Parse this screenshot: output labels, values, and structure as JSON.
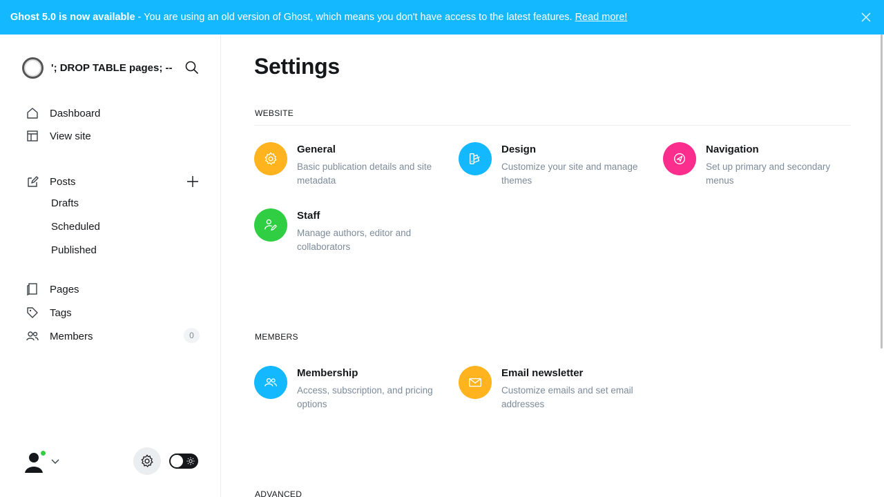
{
  "banner": {
    "bold": "Ghost 5.0 is now available",
    "text": "- You are using an old version of Ghost, which means you don't have access to the latest features.",
    "link": "Read more!"
  },
  "sidebar": {
    "site_title": "'; DROP TABLE pages; --",
    "nav": {
      "dashboard": "Dashboard",
      "view_site": "View site",
      "posts": "Posts",
      "drafts": "Drafts",
      "scheduled": "Scheduled",
      "published": "Published",
      "pages": "Pages",
      "tags": "Tags",
      "members": "Members",
      "members_count": "0"
    }
  },
  "main": {
    "title": "Settings",
    "sections": {
      "website": "WEBSITE",
      "members": "MEMBERS",
      "advanced": "ADVANCED"
    },
    "cards": {
      "general": {
        "title": "General",
        "desc": "Basic publication details and site metadata",
        "color": "#ffb41f"
      },
      "design": {
        "title": "Design",
        "desc": "Customize your site and manage themes",
        "color": "#14b8ff"
      },
      "navigation": {
        "title": "Navigation",
        "desc": "Set up primary and secondary menus",
        "color": "#fb2d8d"
      },
      "staff": {
        "title": "Staff",
        "desc": "Manage authors, editor and collaborators",
        "color": "#30cf43"
      },
      "membership": {
        "title": "Membership",
        "desc": "Access, subscription, and pricing options",
        "color": "#14b8ff"
      },
      "email_newsletter": {
        "title": "Email newsletter",
        "desc": "Customize emails and set email addresses",
        "color": "#ffb41f"
      }
    }
  },
  "icons": [
    "close-icon",
    "search-icon",
    "home-icon",
    "view-site-icon",
    "posts-icon",
    "plus-icon",
    "pages-icon",
    "tags-icon",
    "members-icon",
    "avatar-icon",
    "chevron-down-icon",
    "gear-icon",
    "sun-icon"
  ]
}
